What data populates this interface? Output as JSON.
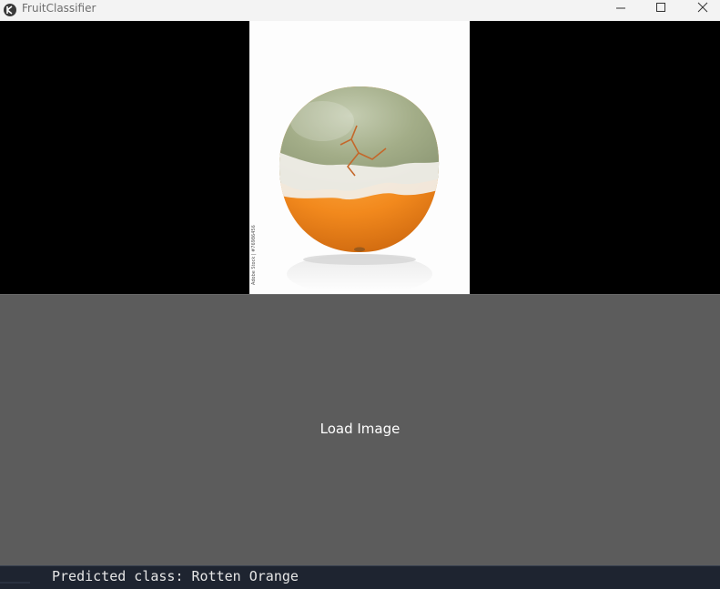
{
  "window": {
    "title": "FruitClassifier",
    "icon": "kivy-app-icon",
    "controls": [
      "minimize-icon",
      "maximize-icon",
      "close-icon"
    ]
  },
  "image_panel": {
    "image_description": "moldy-rotten-orange-photo",
    "watermark": "Adobe Stock | #76986456"
  },
  "load_button": {
    "label": "Load Image"
  },
  "status": {
    "text": "Predicted class: Rotten Orange"
  },
  "colors": {
    "titlebar_bg": "#f3f3f3",
    "button_bg": "#5c5c5c",
    "status_bg": "#1e2430",
    "orange": "#f08a1c",
    "mold_green": "#9aa67f"
  }
}
